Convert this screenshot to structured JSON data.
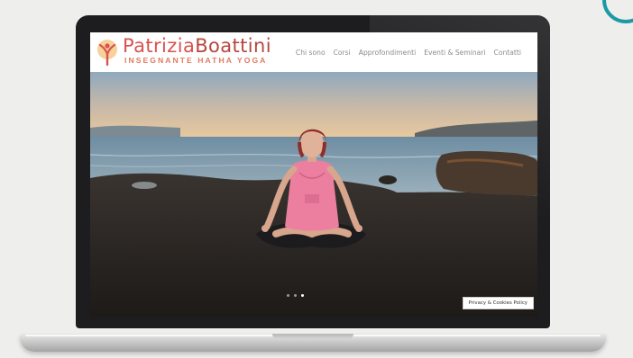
{
  "site": {
    "brand_first": "Patrizia",
    "brand_last": "Boattini",
    "tagline": "INSEGNANTE HATHA YOGA",
    "logo_icon": "lotus-figure-icon"
  },
  "nav": {
    "items": [
      {
        "label": "Chi sono"
      },
      {
        "label": "Corsi"
      },
      {
        "label": "Approfondimenti"
      },
      {
        "label": "Eventi & Seminari"
      },
      {
        "label": "Contatti"
      }
    ]
  },
  "hero": {
    "image_description": "woman meditating seated cross-legged on rocks by the sea at sunset",
    "slides_total": 3,
    "active_slide": 3
  },
  "footer": {
    "privacy_label": "Privacy & Cookies Policy"
  },
  "colors": {
    "brand_primary": "#c0392b",
    "brand_secondary": "#e27a5f",
    "badge": "#1b9aa6"
  }
}
